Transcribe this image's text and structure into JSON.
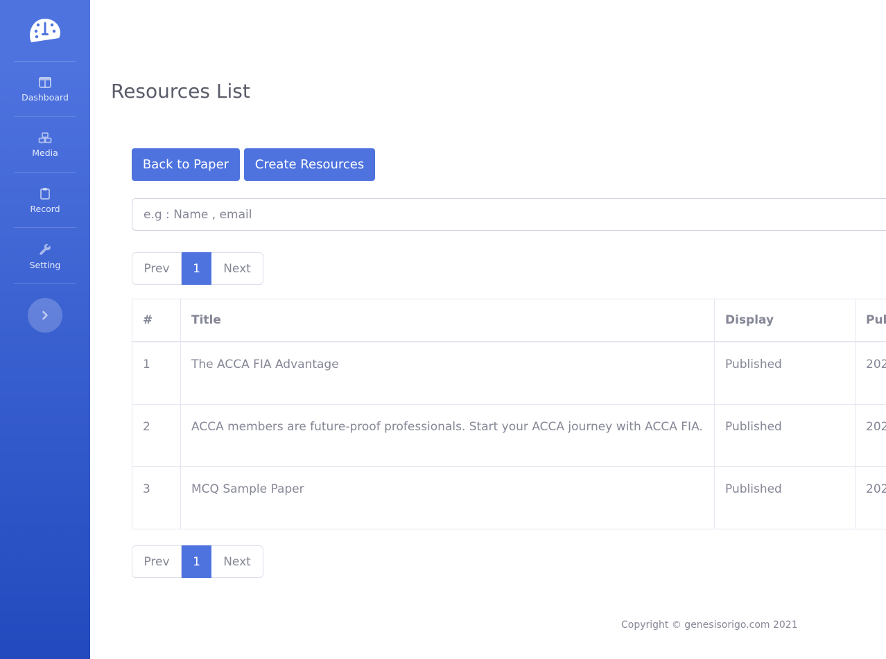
{
  "sidebar": {
    "nav": [
      {
        "label": "Dashboard",
        "icon": "table-icon"
      },
      {
        "label": "Media",
        "icon": "boxes-icon"
      },
      {
        "label": "Record",
        "icon": "clipboard-icon"
      },
      {
        "label": "Setting",
        "icon": "wrench-icon"
      }
    ],
    "toggle_icon": "chevron-right-icon"
  },
  "page": {
    "title": "Resources List"
  },
  "actions": {
    "back_label": "Back to Paper",
    "create_label": "Create Resources"
  },
  "search": {
    "placeholder": "e.g : Name , email",
    "value": ""
  },
  "pagination": {
    "prev": "Prev",
    "current": "1",
    "next": "Next"
  },
  "table": {
    "headers": [
      "#",
      "Title",
      "Display",
      "Pub"
    ],
    "rows": [
      {
        "num": "1",
        "title": "The ACCA FIA Advantage",
        "display": "Published",
        "published": "202"
      },
      {
        "num": "2",
        "title": "ACCA members are future-proof professionals. Start your ACCA journey with ACCA FIA.",
        "display": "Published",
        "published": "202"
      },
      {
        "num": "3",
        "title": "MCQ Sample Paper",
        "display": "Published",
        "published": "202"
      }
    ]
  },
  "footer": {
    "copyright": "Copyright © genesisorigo.com 2021"
  },
  "colors": {
    "primary": "#4e73df",
    "sidebar_bottom": "#224abe",
    "text": "#858796",
    "border": "#e3e6f0"
  }
}
